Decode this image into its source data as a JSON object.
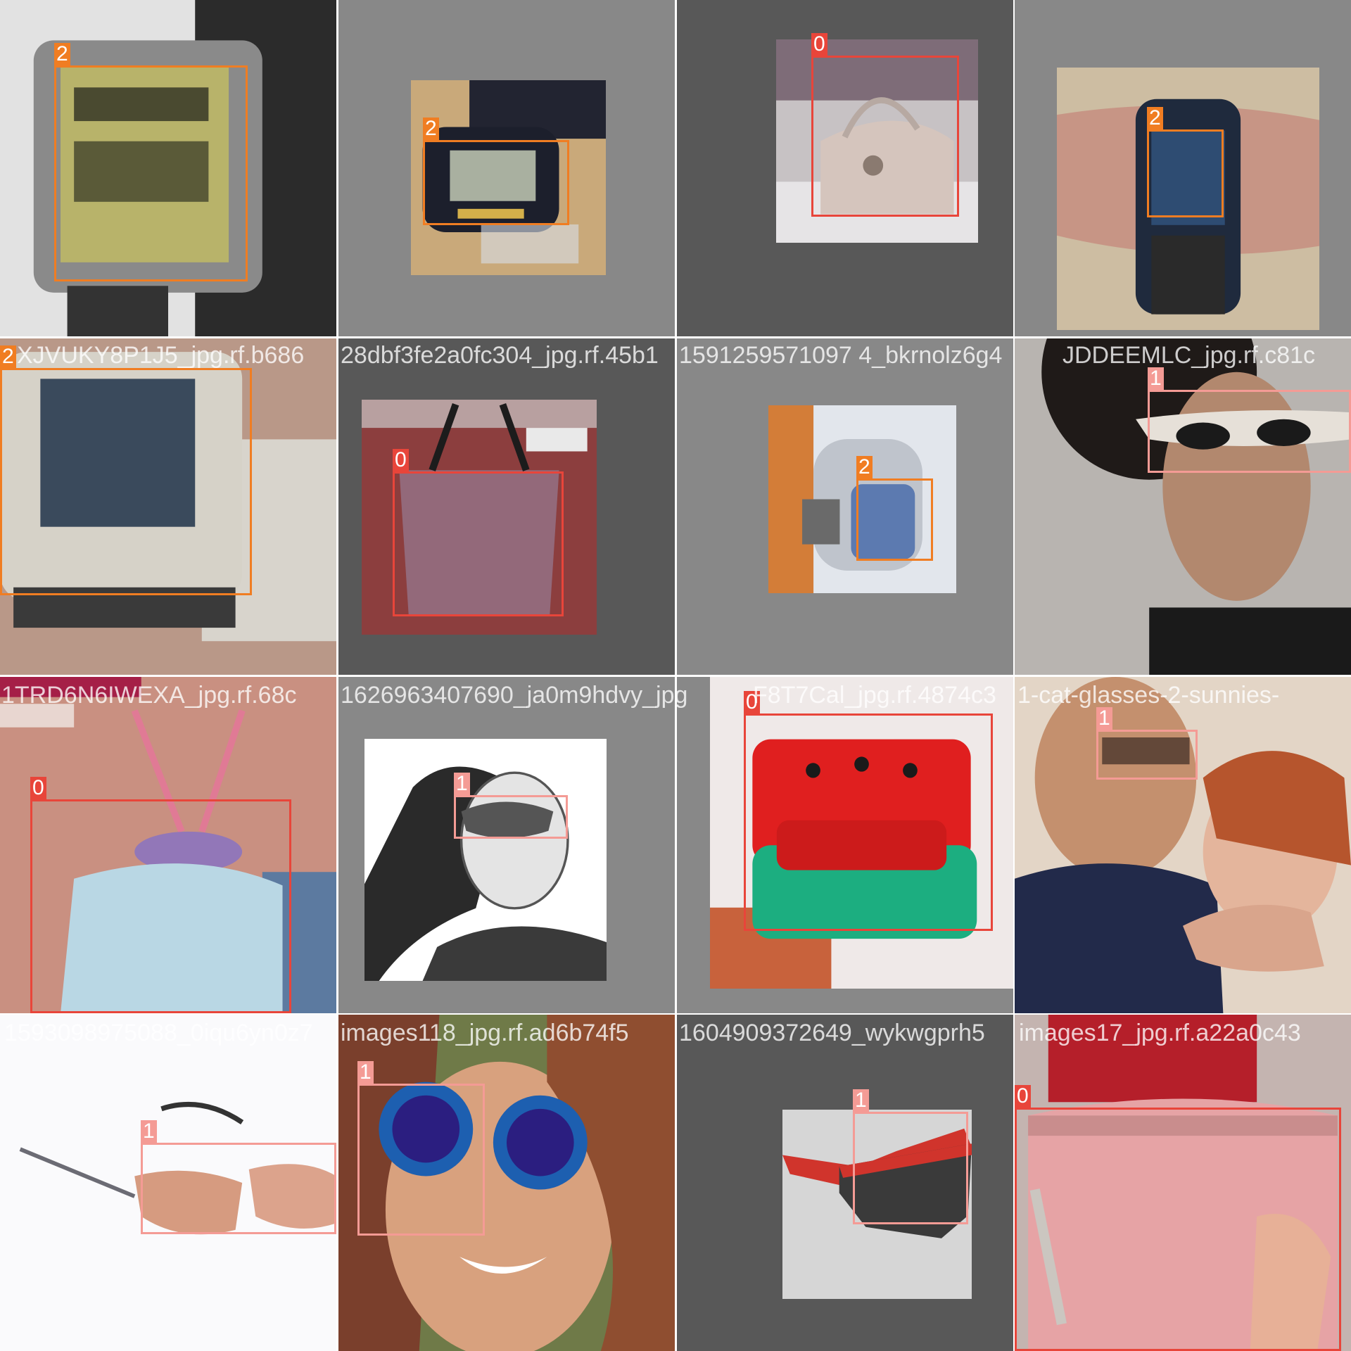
{
  "colors": {
    "class_0": "#e8453a",
    "class_1": "#f49b95",
    "class_2": "#f07d22",
    "padding_dark": "#585858",
    "padding_mid": "#888888",
    "filename_text": "#ffffff"
  },
  "mosaic": {
    "filenames": [
      "XJVUKY8P1J5_jpg.rf.b686",
      "28dbf3fe2a0fc304_jpg.rf.45b1",
      "1591259571097 4_bkrnolz6g4",
      "JDDEEMLC_jpg.rf.c81c",
      "1TRD6N6IWEXA_jpg.rf.68c",
      "1626963407690_ja0m9hdvy_jpg",
      "F8T7Cal_jpg.rf.4874c3",
      "1-cat-glasses-2-sunnies-",
      "1593098975088_0iqu6yn0z7",
      "images118_jpg.rf.ad6b74f5",
      "1604909372649_wykwgprh5",
      "images17_jpg.rf.a22a0c43"
    ],
    "tiles": [
      {
        "label": "2",
        "subject": "watch"
      },
      {
        "label": "2",
        "subject": "watch"
      },
      {
        "label": "0",
        "subject": "bag"
      },
      {
        "label": "2",
        "subject": "watch"
      },
      {
        "label": "2",
        "subject": "watch"
      },
      {
        "label": "0",
        "subject": "bag"
      },
      {
        "label": "2",
        "subject": "watch"
      },
      {
        "label": "1",
        "subject": "sunglasses"
      },
      {
        "label": "0",
        "subject": "bag"
      },
      {
        "label": "1",
        "subject": "sunglasses"
      },
      {
        "label": "0",
        "subject": "bag"
      },
      {
        "label": "1",
        "subject": "sunglasses"
      },
      {
        "label": "1",
        "subject": "sunglasses"
      },
      {
        "label": "1",
        "subject": "sunglasses"
      },
      {
        "label": "1",
        "subject": "sunglasses"
      },
      {
        "label": "0",
        "subject": "bag"
      }
    ]
  }
}
